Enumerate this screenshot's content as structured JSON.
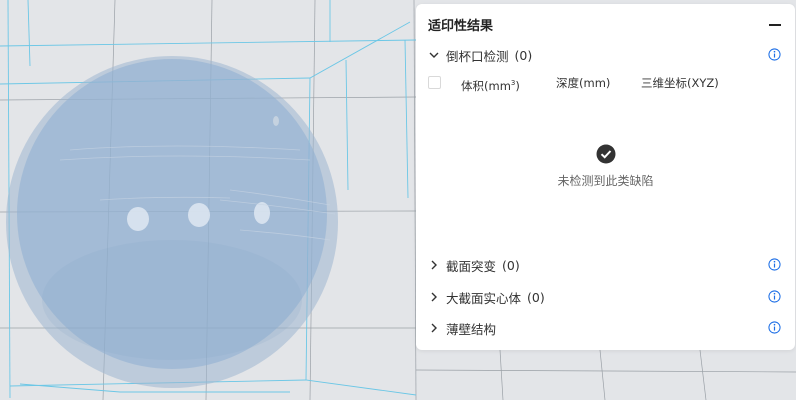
{
  "panel": {
    "title": "适印性结果",
    "collapse_icon": "minus-icon"
  },
  "sections": [
    {
      "label": "倒杯口检测",
      "count": "(0)",
      "expanded": true,
      "icon": "info-icon"
    },
    {
      "label": "截面突变",
      "count": "(0)",
      "expanded": false,
      "icon": "info-icon"
    },
    {
      "label": "大截面实心体",
      "count": "(0)",
      "expanded": false,
      "icon": "info-icon"
    },
    {
      "label": "薄壁结构",
      "count": "",
      "expanded": false,
      "icon": "info-icon"
    }
  ],
  "table": {
    "columns": {
      "volume": "体积(mm",
      "volume_sup": "3",
      "volume_close": ")",
      "depth": "深度(mm)",
      "coord": "三维坐标(XYZ)"
    }
  },
  "empty_state": {
    "icon": "check-circle-icon",
    "text": "未检测到此类缺陷"
  },
  "colors": {
    "accent": "#1c6ee6",
    "sphere_outer": "#9fb6cf",
    "sphere_inner": "#8eaed2",
    "grid_line": "#6cc7e6"
  }
}
